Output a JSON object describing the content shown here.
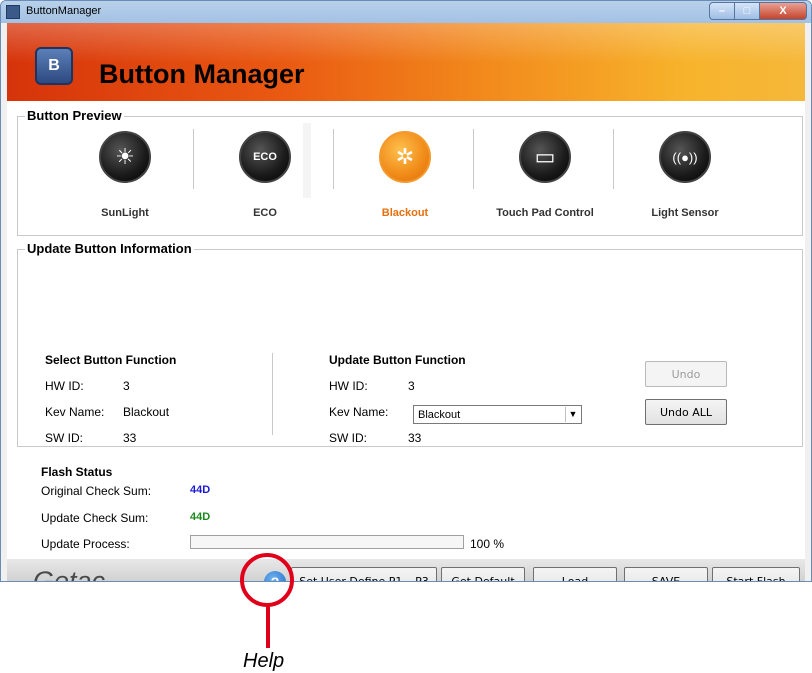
{
  "window": {
    "title": "ButtonManager",
    "minimize": "–",
    "maximize": "□",
    "close": "X"
  },
  "header": {
    "logo_text": "B",
    "title": "Button Manager"
  },
  "preview": {
    "group_title": "Button Preview",
    "items": [
      {
        "label": "SunLight",
        "icon": "sunlight-icon",
        "glyph": "☀"
      },
      {
        "label": "ECO",
        "icon": "eco-icon",
        "glyph": "ECO"
      },
      {
        "label": "Blackout",
        "icon": "blackout-icon",
        "glyph": "✲"
      },
      {
        "label": "Touch Pad Control",
        "icon": "touchpad-icon",
        "glyph": "▭"
      },
      {
        "label": "Light Sensor",
        "icon": "light-sensor-icon",
        "glyph": "((●))"
      }
    ],
    "active_index": 2
  },
  "update": {
    "group_title": "Update Button Information",
    "select": {
      "heading": "Select Button Function",
      "hw_label": "HW ID:",
      "hw_value": "3",
      "key_label": "Kev Name:",
      "key_value": "Blackout",
      "sw_label": "SW ID:",
      "sw_value": "33"
    },
    "target": {
      "heading": "Update Button Function",
      "hw_label": "HW ID:",
      "hw_value": "3",
      "key_label": "Kev Name:",
      "key_value": "Blackout",
      "sw_label": "SW ID:",
      "sw_value": "33"
    },
    "undo_label": "Undo",
    "undo_all_label": "Undo ALL"
  },
  "flash": {
    "heading": "Flash Status",
    "original_label": "Original Check Sum:",
    "original_value": "44D",
    "update_label": "Update Check Sum:",
    "update_value": "44D",
    "process_label": "Update Process:",
    "process_value": "100 %",
    "process_fraction": 0.0
  },
  "footer": {
    "brand": "Getac",
    "help_glyph": "?",
    "set_user_label": "Set User Define P1 ~P3",
    "get_default_label": "Get Default",
    "load_label": "Load",
    "save_label": "SAVE",
    "start_flash_label": "Start Flash"
  },
  "callout": {
    "label": "Help"
  },
  "colors": {
    "accent": "#e8700e",
    "checksum_original": "#1a1ad6",
    "checksum_update": "#1a8a1a",
    "callout": "#e0001a"
  }
}
